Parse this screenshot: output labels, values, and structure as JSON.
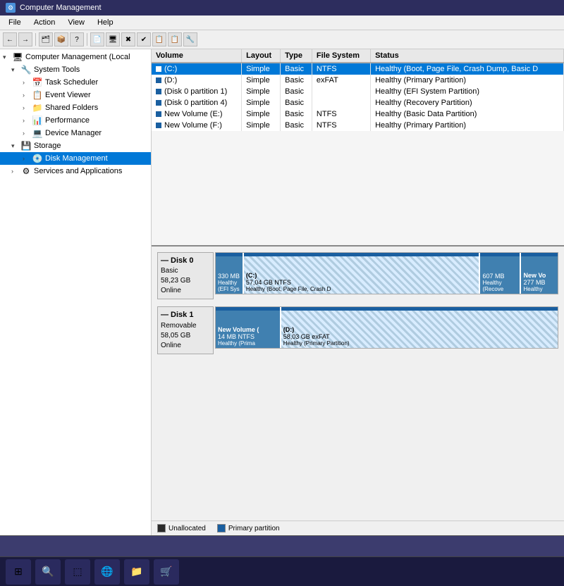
{
  "titleBar": {
    "label": "Computer Management",
    "icon": "⚙"
  },
  "menuBar": {
    "items": [
      "File",
      "Action",
      "View",
      "Help"
    ]
  },
  "toolbar": {
    "buttons": [
      "←",
      "→",
      "📋",
      "📦",
      "?",
      "📄",
      "🖥",
      "✖",
      "✔",
      "📋",
      "📋",
      "🔧"
    ]
  },
  "sidebar": {
    "items": [
      {
        "id": "computer-management",
        "label": "Computer Management (Local",
        "level": 0,
        "expanded": true,
        "icon": "🖥"
      },
      {
        "id": "system-tools",
        "label": "System Tools",
        "level": 1,
        "expanded": true,
        "icon": "🔧"
      },
      {
        "id": "task-scheduler",
        "label": "Task Scheduler",
        "level": 2,
        "expanded": false,
        "icon": "📅"
      },
      {
        "id": "event-viewer",
        "label": "Event Viewer",
        "level": 2,
        "expanded": false,
        "icon": "📋"
      },
      {
        "id": "shared-folders",
        "label": "Shared Folders",
        "level": 2,
        "expanded": false,
        "icon": "📁"
      },
      {
        "id": "performance",
        "label": "Performance",
        "level": 2,
        "expanded": false,
        "icon": "📊"
      },
      {
        "id": "device-manager",
        "label": "Device Manager",
        "level": 2,
        "expanded": false,
        "icon": "💻"
      },
      {
        "id": "storage",
        "label": "Storage",
        "level": 1,
        "expanded": true,
        "icon": "💾"
      },
      {
        "id": "disk-management",
        "label": "Disk Management",
        "level": 2,
        "expanded": false,
        "icon": "💿",
        "selected": true
      },
      {
        "id": "services-apps",
        "label": "Services and Applications",
        "level": 1,
        "expanded": false,
        "icon": "⚙"
      }
    ]
  },
  "volumeTable": {
    "columns": [
      "Volume",
      "Layout",
      "Type",
      "File System",
      "Status"
    ],
    "rows": [
      {
        "volume": "(C:)",
        "layout": "Simple",
        "type": "Basic",
        "fs": "NTFS",
        "status": "Healthy (Boot, Page File, Crash Dump, Basic D",
        "selected": true
      },
      {
        "volume": "(D:)",
        "layout": "Simple",
        "type": "Basic",
        "fs": "exFAT",
        "status": "Healthy (Primary Partition)",
        "selected": false
      },
      {
        "volume": "(Disk 0 partition 1)",
        "layout": "Simple",
        "type": "Basic",
        "fs": "",
        "status": "Healthy (EFI System Partition)",
        "selected": false
      },
      {
        "volume": "(Disk 0 partition 4)",
        "layout": "Simple",
        "type": "Basic",
        "fs": "",
        "status": "Healthy (Recovery Partition)",
        "selected": false
      },
      {
        "volume": "New Volume (E:)",
        "layout": "Simple",
        "type": "Basic",
        "fs": "NTFS",
        "status": "Healthy (Basic Data Partition)",
        "selected": false
      },
      {
        "volume": "New Volume (F:)",
        "layout": "Simple",
        "type": "Basic",
        "fs": "NTFS",
        "status": "Healthy (Primary Partition)",
        "selected": false
      }
    ]
  },
  "diskArea": {
    "disks": [
      {
        "id": "disk0",
        "name": "Disk 0",
        "type": "Basic",
        "size": "58,23 GB",
        "status": "Online",
        "partitions": [
          {
            "label": "",
            "size": "330 MB",
            "detail": "Healthy (EFI Sys",
            "widthPct": 7,
            "style": "solid-blue"
          },
          {
            "label": "(C:)",
            "size": "57,04 GB NTFS",
            "detail": "Healthy (Boot, Page File, Crash D",
            "widthPct": 72,
            "style": "hatched"
          },
          {
            "label": "",
            "size": "607 MB",
            "detail": "Healthy (Recove",
            "widthPct": 11,
            "style": "solid-blue"
          },
          {
            "label": "New Vo",
            "size": "277 MB",
            "detail": "Healthy",
            "widthPct": 10,
            "style": "solid-blue"
          }
        ]
      },
      {
        "id": "disk1",
        "name": "Disk 1",
        "type": "Removable",
        "size": "58,05 GB",
        "status": "Online",
        "partitions": [
          {
            "label": "New Volume (",
            "size": "14 MB NTFS",
            "detail": "Healthy (Prima",
            "widthPct": 18,
            "style": "solid-blue"
          },
          {
            "label": "(D:)",
            "size": "58,03 GB exFAT",
            "detail": "Healthy (Primary Partition)",
            "widthPct": 82,
            "style": "hatched"
          }
        ]
      }
    ]
  },
  "legend": {
    "items": [
      {
        "label": "Unallocated",
        "color": "#2a2a2a"
      },
      {
        "label": "Primary partition",
        "color": "#1a5fa0"
      }
    ]
  }
}
